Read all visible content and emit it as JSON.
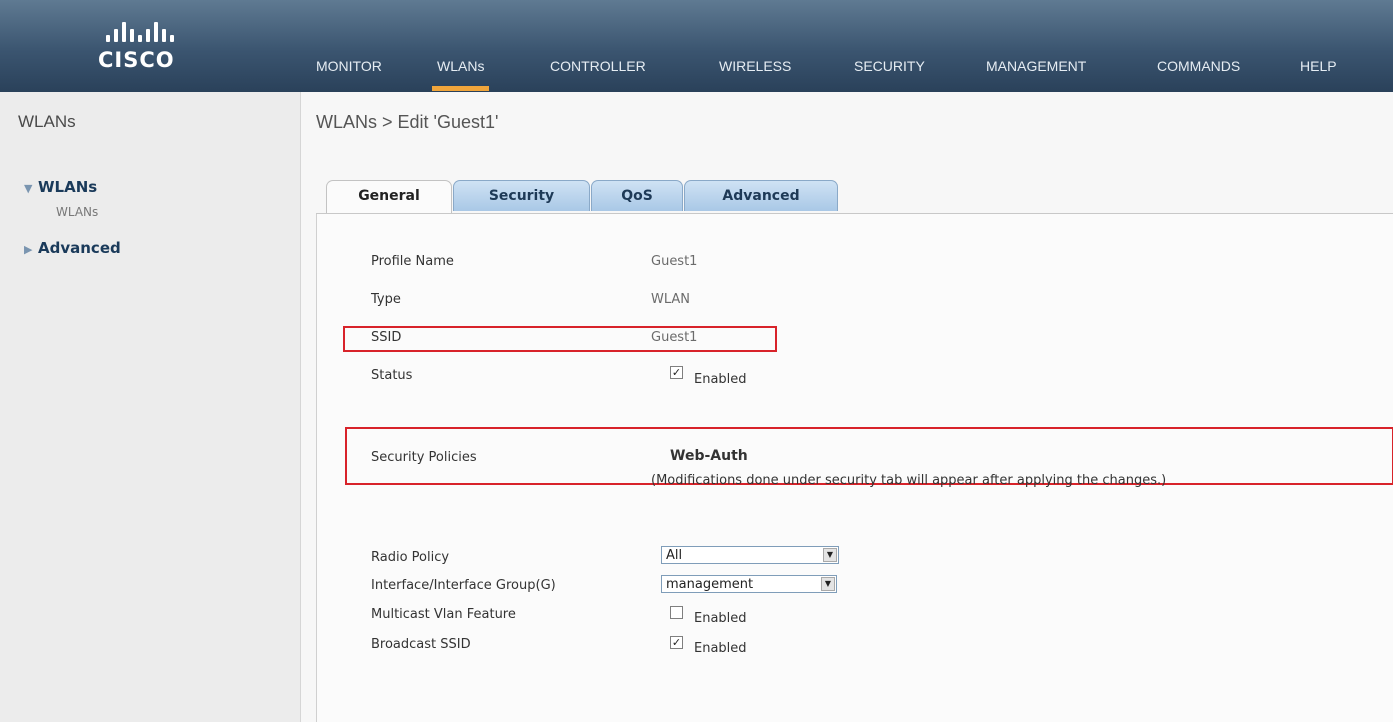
{
  "brand": {
    "logo_text": "CISCO"
  },
  "nav": [
    "MONITOR",
    "WLANs",
    "CONTROLLER",
    "WIRELESS",
    "SECURITY",
    "MANAGEMENT",
    "COMMANDS",
    "HELP"
  ],
  "sidebar": {
    "title": "WLANs",
    "groups": [
      {
        "label": "WLANs",
        "expanded": true,
        "sub": "WLANs"
      },
      {
        "label": "Advanced",
        "expanded": false
      }
    ]
  },
  "page": {
    "title": "WLANs > Edit  'Guest1'"
  },
  "tabs": [
    "General",
    "Security",
    "QoS",
    "Advanced"
  ],
  "active_tab": "General",
  "general": {
    "profile_name_label": "Profile Name",
    "profile_name_value": "Guest1",
    "type_label": "Type",
    "type_value": "WLAN",
    "ssid_label": "SSID",
    "ssid_value": "Guest1",
    "status_label": "Status",
    "status_checked": true,
    "status_text": "Enabled",
    "security_policies_label": "Security Policies",
    "security_policies_value": "Web-Auth",
    "security_note": "(Modifications done under security tab will appear after applying the changes.)",
    "radio_policy_label": "Radio Policy",
    "radio_policy_value": "All",
    "interface_label": "Interface/Interface Group(G)",
    "interface_value": "management",
    "multicast_label": "Multicast Vlan Feature",
    "multicast_checked": false,
    "multicast_text": "Enabled",
    "broadcast_label": "Broadcast SSID",
    "broadcast_checked": true,
    "broadcast_text": "Enabled"
  },
  "colors": {
    "highlight_box": "#d8232a",
    "nav_active": "#f0a53b"
  }
}
